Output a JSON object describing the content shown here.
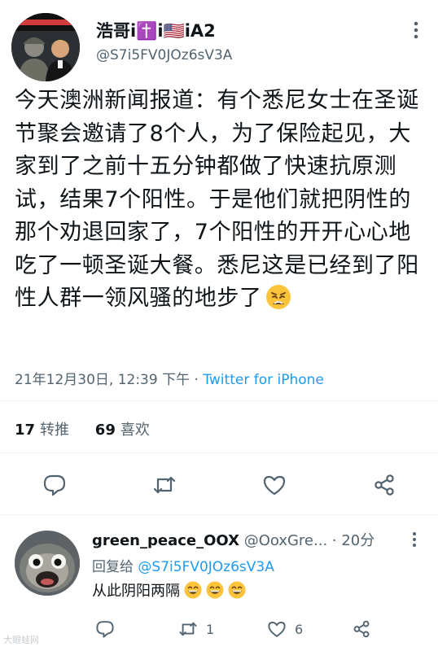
{
  "tweet": {
    "author_name": "浩哥i✝️i🇺🇸iA2",
    "author_handle": "@S7i5FV0JOz6sV3A",
    "text": "今天澳洲新闻报道：有个悉尼女士在圣诞节聚会邀请了8个人，为了保险起见，大家到了之前十五分钟都做了快速抗原测试，结果7个阳性。于是他们就把阴性的那个劝退回家了，7个阳性的开开心心地吃了一顿圣诞大餐。悉尼这是已经到了阳性人群一领风骚的地步了",
    "text_emoji": "weary-face-emoji",
    "timestamp": "21年12月30日, 12:39 下午",
    "separator": "·",
    "source": "Twitter for iPhone",
    "retweets_count": "17",
    "retweets_label": "转推",
    "likes_count": "69",
    "likes_label": "喜欢"
  },
  "reply": {
    "author_name": "green_peace_OOX",
    "author_handle": "@OoxGre...",
    "time": "· 20分",
    "reply_label": "回复给",
    "reply_mention": "@S7i5FV0JOz6sV3A",
    "text": "从此阴阳两隔",
    "text_emojis": [
      "grinning-face-emoji",
      "grinning-face-emoji",
      "grinning-face-emoji"
    ],
    "retweet_count": "1",
    "like_count": "6"
  },
  "watermark": "大眼蛙网",
  "colors": {
    "text": "#0f1419",
    "secondary": "#536471",
    "link": "#1d9bf0",
    "divider": "#eff3f4"
  }
}
